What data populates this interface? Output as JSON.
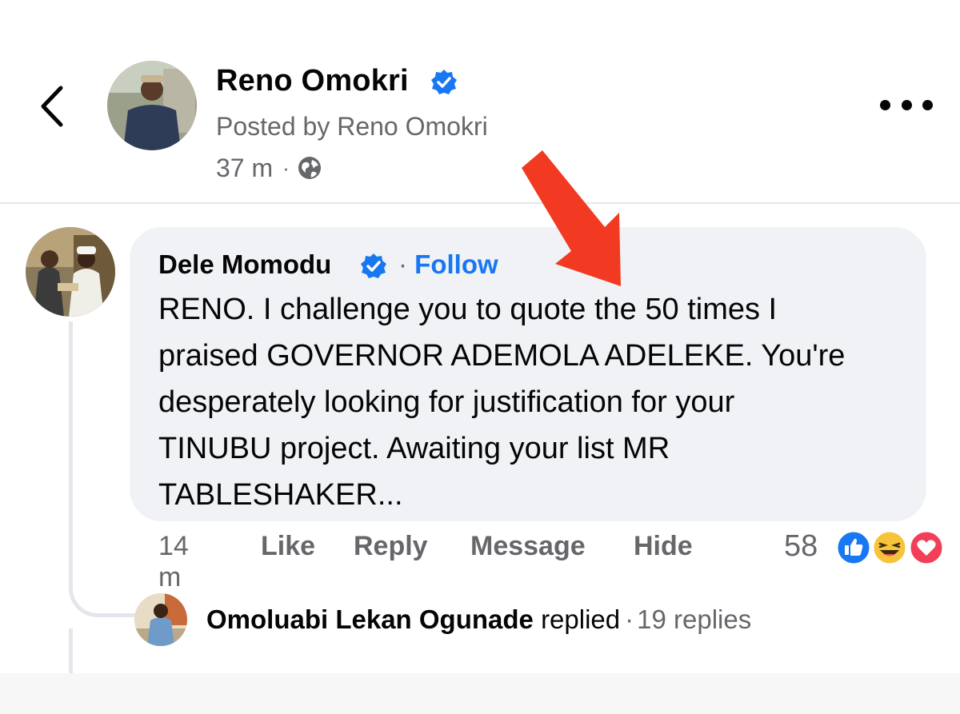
{
  "post": {
    "author_name": "Reno Omokri",
    "posted_by": "Posted by Reno Omokri",
    "time": "37 m",
    "separator": "·",
    "privacy_icon": "globe-icon"
  },
  "comment": {
    "author_name": "Dele Momodu",
    "follow_prefix": "·",
    "follow_label": "Follow",
    "text": "RENO. I challenge you to quote the 50 times I\npraised GOVERNOR ADEMOLA ADELEKE. You're\ndesperately looking for justification for your\nTINUBU project. Awaiting your list MR\nTABLESHAKER...",
    "time": "14 m",
    "actions": {
      "like": "Like",
      "reply": "Reply",
      "message": "Message",
      "hide": "Hide"
    },
    "reaction_count": "58",
    "reaction_icons": [
      "like-icon",
      "haha-icon",
      "love-icon"
    ]
  },
  "reply_preview": {
    "name": "Omoluabi Lekan Ogunade",
    "verb": "replied",
    "separator": "·",
    "count": "19 replies"
  },
  "colors": {
    "accent": "#1877f2",
    "secondary_text": "#65676b",
    "bubble": "#f0f2f5",
    "annotation_arrow": "#f23a22"
  }
}
